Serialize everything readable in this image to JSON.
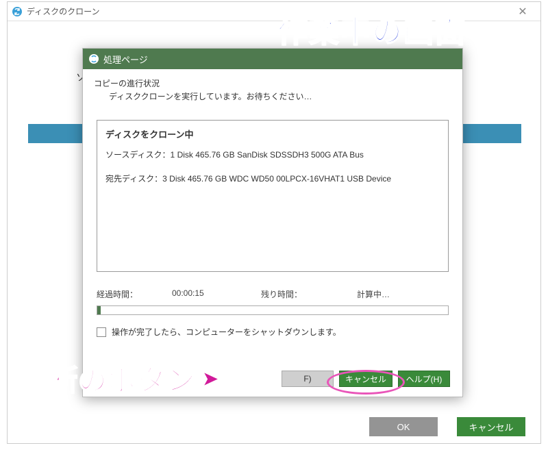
{
  "outer_window": {
    "title": "ディスクのクローン",
    "partial_label": "ソ",
    "buttons": {
      "ok": "OK",
      "cancel": "キャンセル"
    }
  },
  "dialog": {
    "title": "処理ページ",
    "progress_heading": "コピーの進行状況",
    "progress_message": "ディスククローンを実行しています。お待ちください…",
    "status": {
      "heading": "ディスクをクローン中",
      "source_line": "ソースディスク：1 Disk 465.76 GB SanDisk SDSSDH3 500G ATA Bus",
      "dest_line": "宛先ディスク：3 Disk 465.76 GB WDC WD50 00LPCX-16VHAT1 USB Device"
    },
    "time": {
      "elapsed_label": "経過時間：",
      "elapsed_value": "00:00:15",
      "remaining_label": "残り時間：",
      "remaining_value": "計算中…"
    },
    "shutdown_checkbox": "操作が完了したら、コンピューターをシャットダウンします。",
    "buttons": {
      "finish": "F)",
      "cancel": "キャンセル",
      "help": "ヘルプ(H)"
    }
  },
  "annotations": {
    "top": "作業中の画面",
    "bottom": "禁断のボタン"
  }
}
